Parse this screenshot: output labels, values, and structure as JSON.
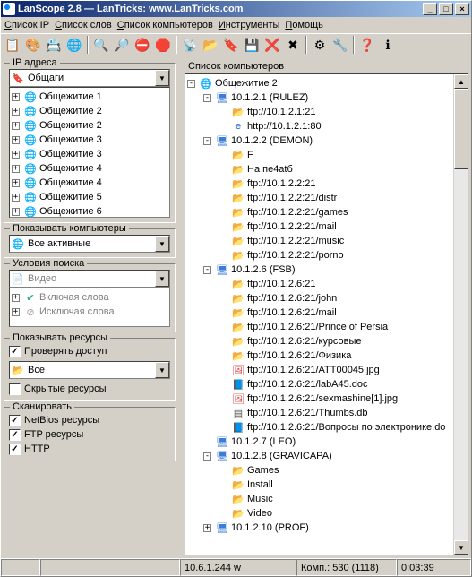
{
  "title": "LanScope 2.8 — LanTricks: www.LanTricks.com",
  "menu": [
    "Список IP",
    "Список слов",
    "Список компьютеров",
    "Инструменты",
    "Помощь"
  ],
  "toolbar_icons": [
    "list-icon",
    "palette-icon",
    "server-icon",
    "globe-icon",
    "sep",
    "zoom-in-icon",
    "zoom-out-icon",
    "icon1",
    "stop-icon",
    "sep",
    "server2-icon",
    "folder-icon",
    "bookmark-icon",
    "save-icon",
    "clear-icon",
    "cancel-icon",
    "sep",
    "gear-icon",
    "settings-icon",
    "sep",
    "help-icon",
    "about-icon"
  ],
  "toolbar_glyphs": {
    "list-icon": "📋",
    "palette-icon": "🎨",
    "server-icon": "📇",
    "globe-icon": "🌐",
    "zoom-in-icon": "🔍",
    "zoom-out-icon": "🔎",
    "icon1": "⛔",
    "stop-icon": "🛑",
    "server2-icon": "📡",
    "folder-icon": "📂",
    "bookmark-icon": "🔖",
    "save-icon": "💾",
    "clear-icon": "❌",
    "cancel-icon": "✖",
    "gear-icon": "⚙",
    "settings-icon": "🔧",
    "help-icon": "❓",
    "about-icon": "ℹ"
  },
  "left": {
    "ip_group": "IP адреса",
    "ip_combo": "Общаги",
    "dorms": [
      "Общежитие 1",
      "Общежитие 2",
      "Общежитие 2",
      "Общежитие 3",
      "Общежитие 3",
      "Общежитие 4",
      "Общежитие 4",
      "Общежитие 5",
      "Общежитие 6"
    ],
    "show_computers_group": "Показывать компьютеры",
    "show_computers_combo": "Все активные",
    "search_group": "Условия поиска",
    "search_combo": "Видео",
    "include_words": "Включая слова",
    "exclude_words": "Исключая слова",
    "show_resources_group": "Показывать ресурсы",
    "check_access": "Проверять доступ",
    "res_combo": "Все",
    "hidden_res": "Скрытые ресурсы",
    "scan_group": "Сканировать",
    "scan_netbios": "NetBios ресурсы",
    "scan_ftp": "FTP ресурсы",
    "scan_http": "HTTP"
  },
  "right": {
    "header": "Список компьютеров",
    "tree": [
      {
        "d": 0,
        "exp": "-",
        "ico": "globe",
        "t": "Общежитие 2"
      },
      {
        "d": 1,
        "exp": "-",
        "ico": "pc",
        "t": "10.1.2.1 (RULEZ)"
      },
      {
        "d": 2,
        "exp": "",
        "ico": "folder",
        "t": "ftp://10.1.2.1:21"
      },
      {
        "d": 2,
        "exp": "",
        "ico": "ie",
        "t": "http://10.1.2.1:80"
      },
      {
        "d": 1,
        "exp": "-",
        "ico": "pc",
        "t": "10.1.2.2 (DEMON)"
      },
      {
        "d": 2,
        "exp": "",
        "ico": "folder",
        "t": "F"
      },
      {
        "d": 2,
        "exp": "",
        "ico": "folder",
        "t": "На пе4atб"
      },
      {
        "d": 2,
        "exp": "",
        "ico": "folder",
        "t": "ftp://10.1.2.2:21"
      },
      {
        "d": 2,
        "exp": "",
        "ico": "folder",
        "t": "ftp://10.1.2.2:21/distr"
      },
      {
        "d": 2,
        "exp": "",
        "ico": "folder",
        "t": "ftp://10.1.2.2:21/games"
      },
      {
        "d": 2,
        "exp": "",
        "ico": "folder",
        "t": "ftp://10.1.2.2:21/mail"
      },
      {
        "d": 2,
        "exp": "",
        "ico": "folder",
        "t": "ftp://10.1.2.2:21/music"
      },
      {
        "d": 2,
        "exp": "",
        "ico": "folder",
        "t": "ftp://10.1.2.2:21/porno"
      },
      {
        "d": 1,
        "exp": "-",
        "ico": "pc",
        "t": "10.1.2.6 (FSB)"
      },
      {
        "d": 2,
        "exp": "",
        "ico": "folder",
        "t": "ftp://10.1.2.6:21"
      },
      {
        "d": 2,
        "exp": "",
        "ico": "folder",
        "t": "ftp://10.1.2.6:21/john"
      },
      {
        "d": 2,
        "exp": "",
        "ico": "folder",
        "t": "ftp://10.1.2.6:21/mail"
      },
      {
        "d": 2,
        "exp": "",
        "ico": "folder",
        "t": "ftp://10.1.2.6:21/Prince of Persia"
      },
      {
        "d": 2,
        "exp": "",
        "ico": "folder",
        "t": "ftp://10.1.2.6:21/курсовые"
      },
      {
        "d": 2,
        "exp": "",
        "ico": "folder",
        "t": "ftp://10.1.2.6:21/Физика"
      },
      {
        "d": 2,
        "exp": "",
        "ico": "img",
        "t": "ftp://10.1.2.6:21/ATT00045.jpg"
      },
      {
        "d": 2,
        "exp": "",
        "ico": "doc",
        "t": "ftp://10.1.2.6:21/labA45.doc"
      },
      {
        "d": 2,
        "exp": "",
        "ico": "img",
        "t": "ftp://10.1.2.6:21/sexmashine[1].jpg"
      },
      {
        "d": 2,
        "exp": "",
        "ico": "file",
        "t": "ftp://10.1.2.6:21/Thumbs.db"
      },
      {
        "d": 2,
        "exp": "",
        "ico": "doc",
        "t": "ftp://10.1.2.6:21/Вопросы по электронике.do"
      },
      {
        "d": 1,
        "exp": "",
        "ico": "pc",
        "t": "10.1.2.7 (LEO)"
      },
      {
        "d": 1,
        "exp": "-",
        "ico": "pc",
        "t": "10.1.2.8 (GRAVICAPA)"
      },
      {
        "d": 2,
        "exp": "",
        "ico": "folder",
        "t": "Games"
      },
      {
        "d": 2,
        "exp": "",
        "ico": "folder",
        "t": "Install"
      },
      {
        "d": 2,
        "exp": "",
        "ico": "folder",
        "t": "Music"
      },
      {
        "d": 2,
        "exp": "",
        "ico": "folder",
        "t": "Video"
      },
      {
        "d": 1,
        "exp": "+",
        "ico": "pc",
        "t": "10.1.2.10 (PROF)"
      }
    ]
  },
  "status": {
    "ip": "10.6.1.244 w",
    "count": "Комп.: 530 (1118)",
    "time": "0:03:39"
  }
}
